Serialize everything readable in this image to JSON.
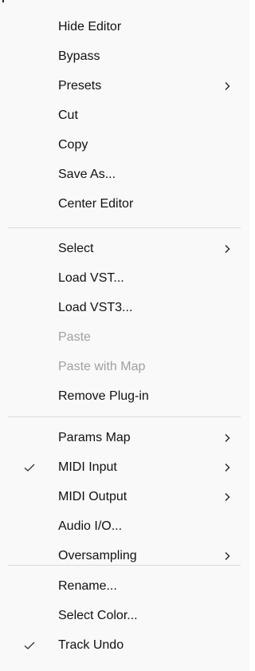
{
  "menu": {
    "groups": [
      {
        "items": [
          {
            "label": "Hide Editor",
            "enabled": true,
            "checked": false,
            "submenu": false
          },
          {
            "label": "Bypass",
            "enabled": true,
            "checked": false,
            "submenu": false
          },
          {
            "label": "Presets",
            "enabled": true,
            "checked": false,
            "submenu": true
          },
          {
            "label": "Cut",
            "enabled": true,
            "checked": false,
            "submenu": false
          },
          {
            "label": "Copy",
            "enabled": true,
            "checked": false,
            "submenu": false
          },
          {
            "label": "Save As...",
            "enabled": true,
            "checked": false,
            "submenu": false
          },
          {
            "label": "Center Editor",
            "enabled": true,
            "checked": false,
            "submenu": false
          }
        ]
      },
      {
        "items": [
          {
            "label": "Select",
            "enabled": true,
            "checked": false,
            "submenu": true
          },
          {
            "label": "Load VST...",
            "enabled": true,
            "checked": false,
            "submenu": false
          },
          {
            "label": "Load VST3...",
            "enabled": true,
            "checked": false,
            "submenu": false
          },
          {
            "label": "Paste",
            "enabled": false,
            "checked": false,
            "submenu": false
          },
          {
            "label": "Paste with Map",
            "enabled": false,
            "checked": false,
            "submenu": false
          },
          {
            "label": "Remove Plug-in",
            "enabled": true,
            "checked": false,
            "submenu": false
          }
        ]
      },
      {
        "items": [
          {
            "label": "Params Map",
            "enabled": true,
            "checked": false,
            "submenu": true
          },
          {
            "label": "MIDI Input",
            "enabled": true,
            "checked": true,
            "submenu": true
          },
          {
            "label": "MIDI Output",
            "enabled": true,
            "checked": false,
            "submenu": true
          },
          {
            "label": "Audio I/O...",
            "enabled": true,
            "checked": false,
            "submenu": false
          },
          {
            "label": "Oversampling",
            "enabled": true,
            "checked": false,
            "submenu": true
          }
        ]
      },
      {
        "items": [
          {
            "label": "Rename...",
            "enabled": true,
            "checked": false,
            "submenu": false
          },
          {
            "label": "Select Color...",
            "enabled": true,
            "checked": false,
            "submenu": false
          },
          {
            "label": "Track Undo",
            "enabled": true,
            "checked": true,
            "submenu": false
          }
        ]
      }
    ],
    "colors": {
      "background": "#f9f9f9",
      "text": "#111111",
      "disabled_text": "#a0a0a0",
      "separator": "#d9d9d9"
    },
    "icons": {
      "check": "checkmark-icon",
      "submenu": "chevron-right-icon"
    }
  }
}
